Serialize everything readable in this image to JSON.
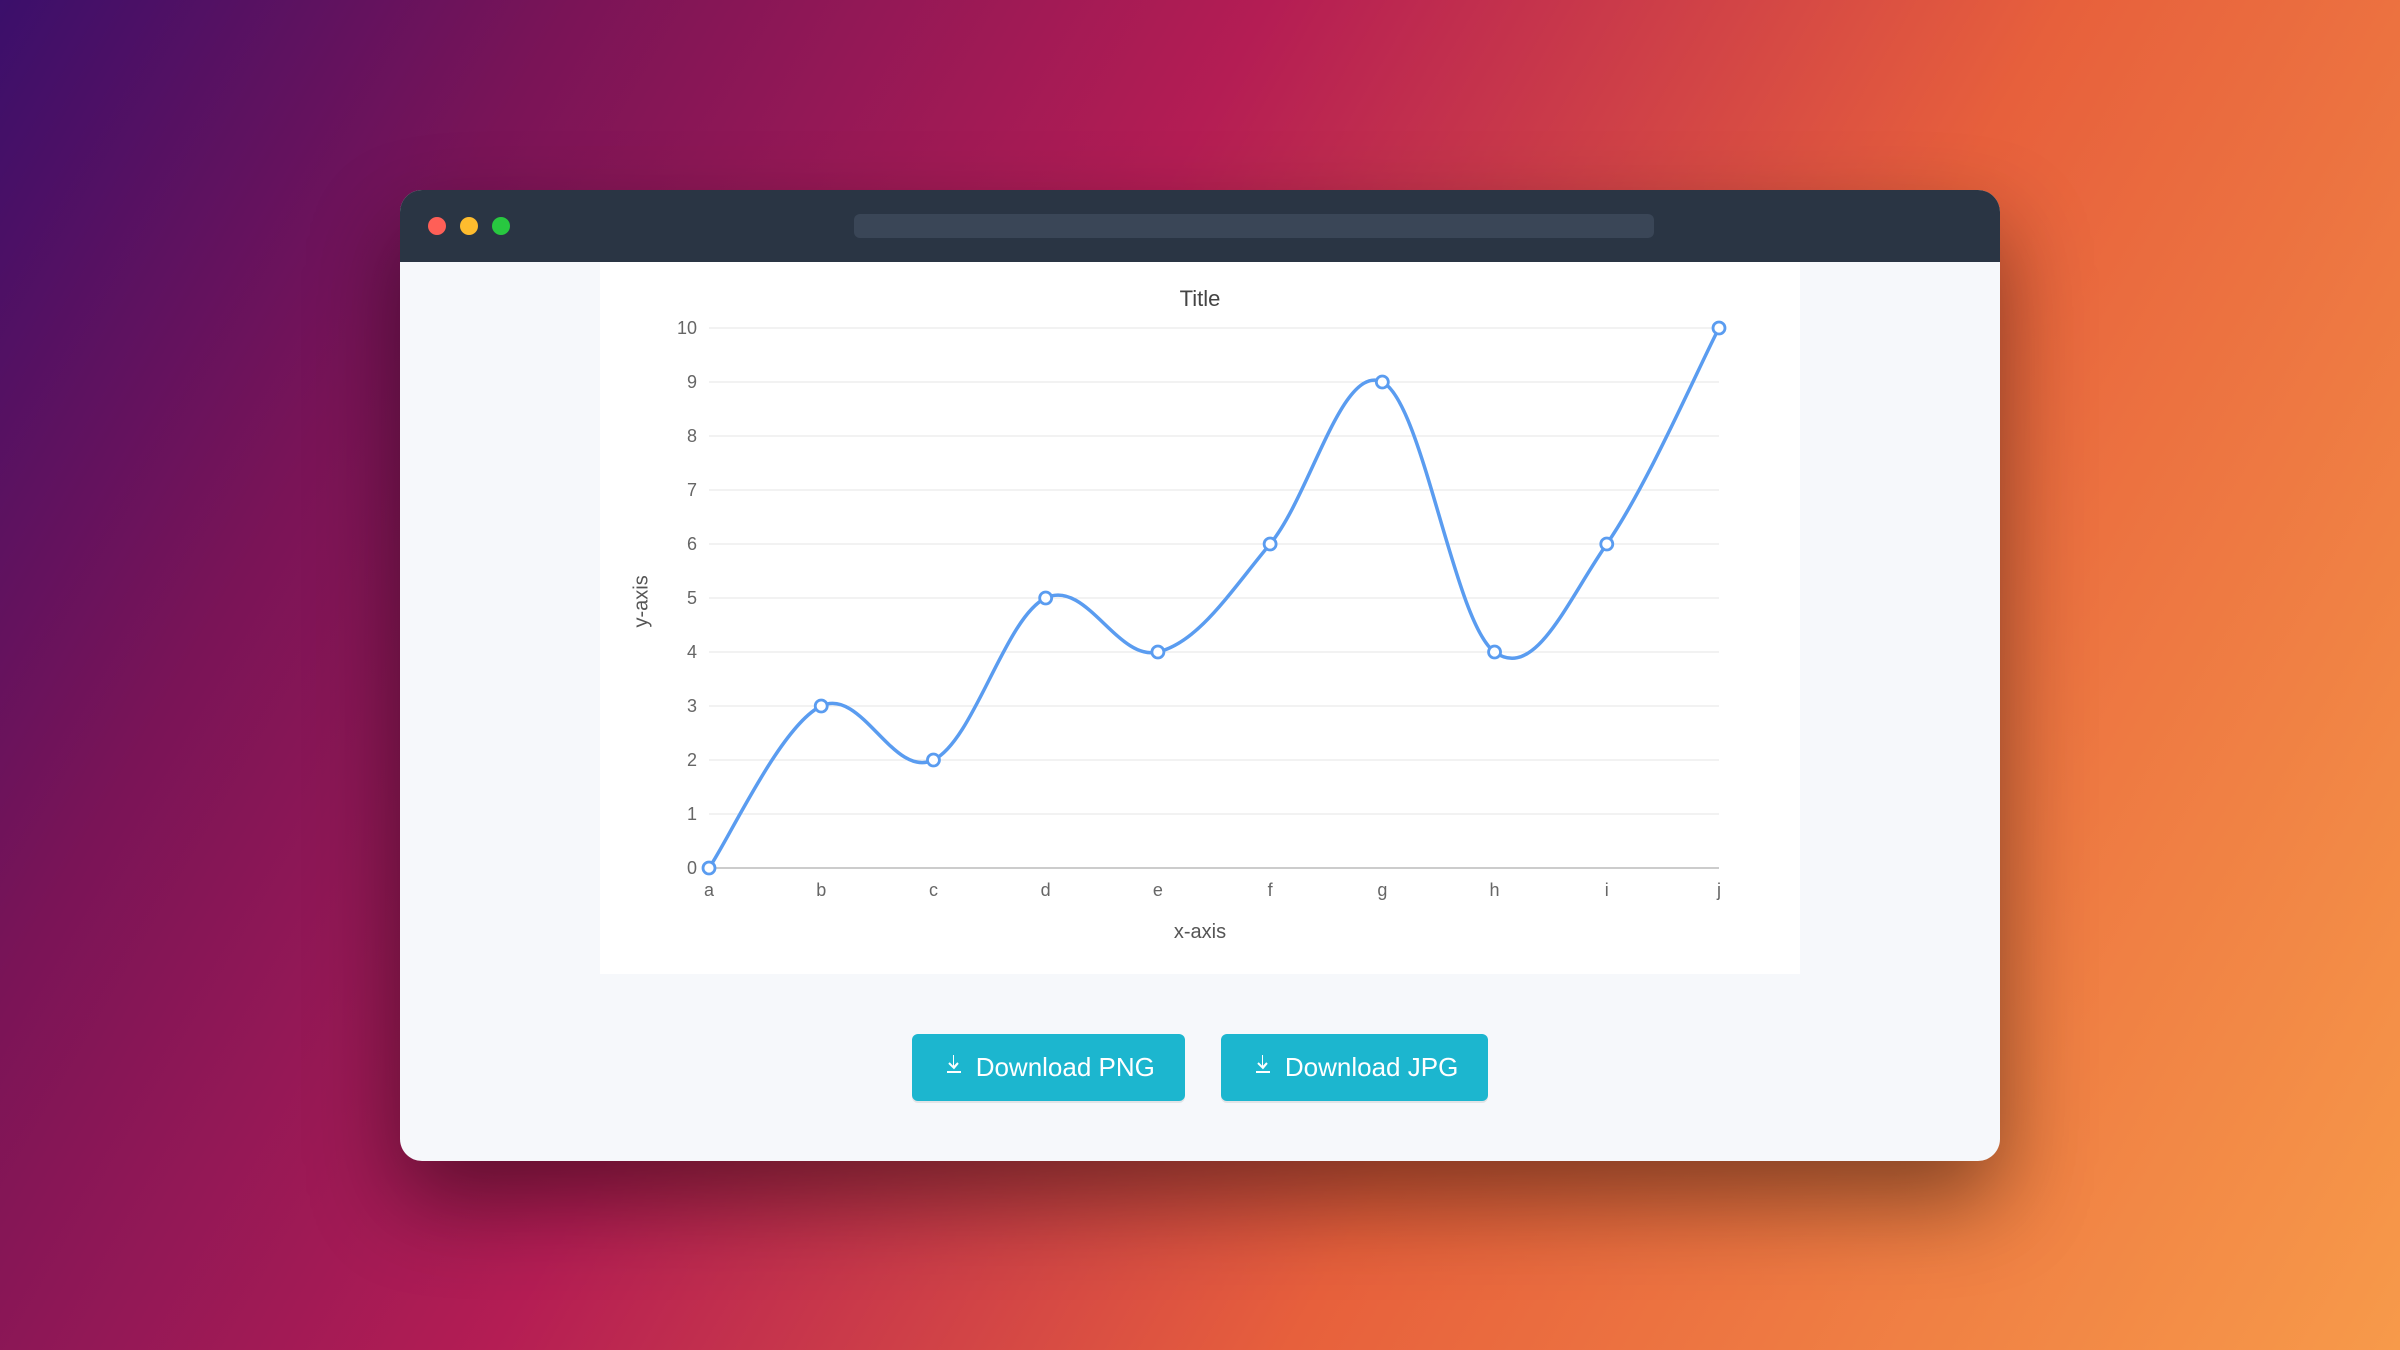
{
  "chart_data": {
    "type": "line",
    "title": "Title",
    "xlabel": "x-axis",
    "ylabel": "y-axis",
    "categories": [
      "a",
      "b",
      "c",
      "d",
      "e",
      "f",
      "g",
      "h",
      "i",
      "j"
    ],
    "values": [
      0,
      3,
      2,
      5,
      4,
      6,
      9,
      4,
      6,
      10
    ],
    "y_ticks": [
      0,
      1,
      2,
      3,
      4,
      5,
      6,
      7,
      8,
      9,
      10
    ],
    "ylim": [
      0,
      10
    ],
    "line_color": "#5a9cf0"
  },
  "buttons": {
    "png_label": "Download PNG",
    "jpg_label": "Download JPG"
  }
}
